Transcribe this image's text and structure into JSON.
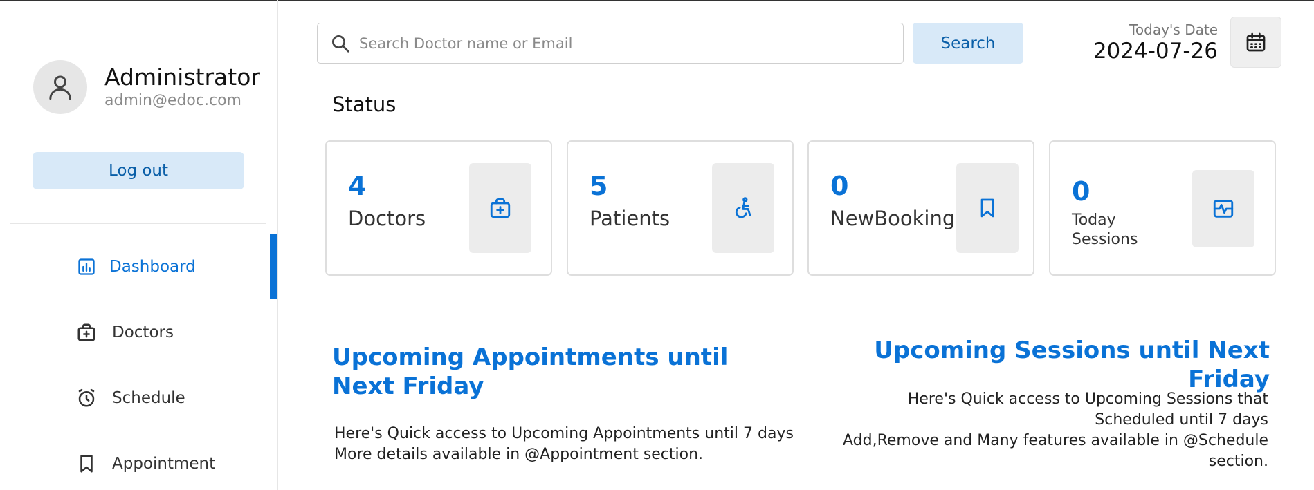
{
  "profile": {
    "name": "Administrator",
    "email": "admin@edoc.com",
    "logout_label": "Log out"
  },
  "nav": {
    "items": [
      {
        "label": "Dashboard",
        "icon": "dashboard-icon",
        "active": true
      },
      {
        "label": "Doctors",
        "icon": "medical-bag-icon",
        "active": false
      },
      {
        "label": "Schedule",
        "icon": "alarm-clock-icon",
        "active": false
      },
      {
        "label": "Appointment",
        "icon": "bookmark-icon",
        "active": false
      }
    ]
  },
  "search": {
    "placeholder": "Search Doctor name or Email",
    "button_label": "Search"
  },
  "date": {
    "label": "Today's Date",
    "value": "2024-07-26"
  },
  "status": {
    "title": "Status",
    "cards": [
      {
        "value": "4",
        "label": "Doctors",
        "icon": "medical-bag-icon"
      },
      {
        "value": "5",
        "label": "Patients",
        "icon": "wheelchair-icon"
      },
      {
        "value": "0",
        "label": "NewBooking",
        "icon": "bookmark-icon"
      },
      {
        "value": "0",
        "label": "Today Sessions",
        "icon": "pulse-icon"
      }
    ]
  },
  "appointments": {
    "title": "Upcoming Appointments until Next Friday",
    "desc_line1": "Here's Quick access to Upcoming Appointments until 7 days",
    "desc_line2": "More details available in @Appointment section."
  },
  "sessions": {
    "title": "Upcoming Sessions until Next Friday",
    "desc_line1": "Here's Quick access to Upcoming Sessions that Scheduled until 7 days",
    "desc_line2": "Add,Remove and Many features available in @Schedule section."
  },
  "colors": {
    "accent": "#0a72d6",
    "button_bg": "#d8e9f8",
    "icon_box_bg": "#ececec"
  }
}
